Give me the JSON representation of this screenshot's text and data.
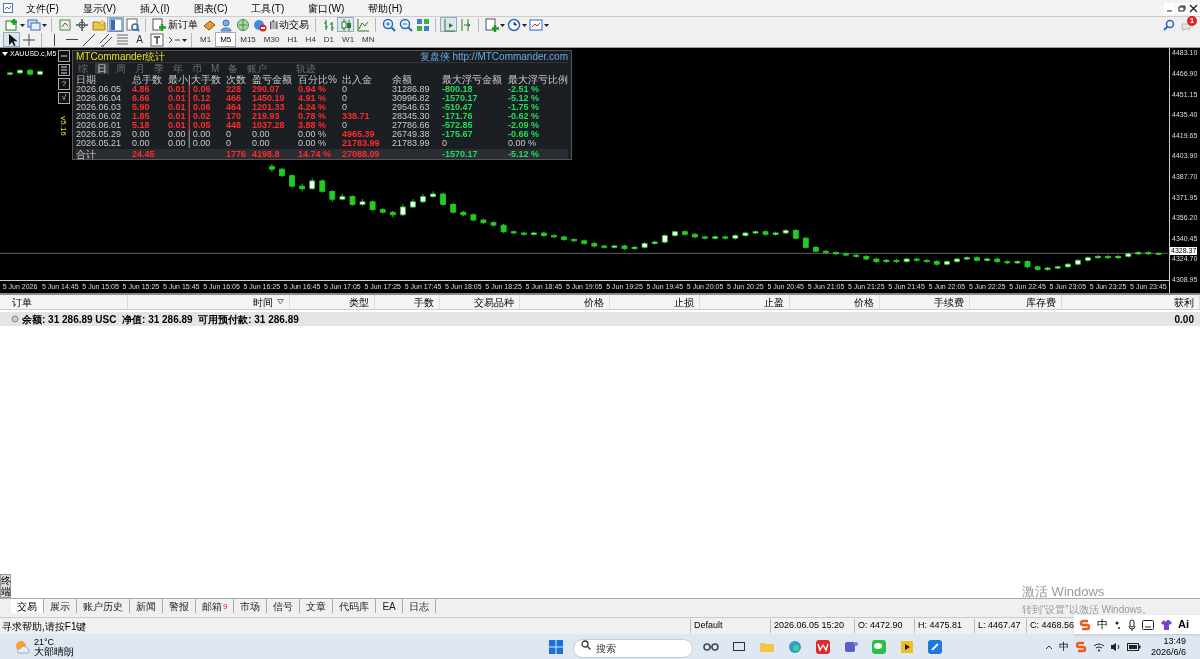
{
  "menu": [
    "文件(F)",
    "显示(V)",
    "插入(I)",
    "图表(C)",
    "工具(T)",
    "窗口(W)",
    "帮助(H)"
  ],
  "toolbar": {
    "new_order": "新订单",
    "auto_trading": "自动交易",
    "text_tool": "A",
    "notification_count": "1"
  },
  "timeframes": [
    {
      "label": "M1",
      "selected": false
    },
    {
      "label": "M5",
      "selected": true
    },
    {
      "label": "M15",
      "selected": false
    },
    {
      "label": "M30",
      "selected": false
    },
    {
      "label": "H1",
      "selected": false
    },
    {
      "label": "H4",
      "selected": false
    },
    {
      "label": "D1",
      "selected": false
    },
    {
      "label": "W1",
      "selected": false
    },
    {
      "label": "MN",
      "selected": false
    }
  ],
  "chart": {
    "tab": "XAUUSD.c,M5",
    "version": "v5.16",
    "current_price": "4328.37",
    "chart_data": {
      "type": "candlestick",
      "ylim": [
        4308.95,
        4483.1
      ],
      "ref_lines": [
        {
          "axis": "y",
          "value": 4328.37
        }
      ],
      "yticks": [
        {
          "value": 4483.1,
          "label": "4483.10"
        },
        {
          "value": 4466.9,
          "label": "4466.90"
        },
        {
          "value": 4451.15,
          "label": "4451.15"
        },
        {
          "value": 4435.4,
          "label": "4435.40"
        },
        {
          "value": 4419.65,
          "label": "4419.65"
        },
        {
          "value": 4403.9,
          "label": "4403.90"
        },
        {
          "value": 4387.7,
          "label": "4387.70"
        },
        {
          "value": 4371.95,
          "label": "4371.95"
        },
        {
          "value": 4356.2,
          "label": "4356.20"
        },
        {
          "value": 4340.45,
          "label": "4340.45"
        },
        {
          "value": 4324.7,
          "label": "4324.70"
        },
        {
          "value": 4308.95,
          "label": "4308.95"
        }
      ],
      "categories": [
        null,
        "5 Jun 2026",
        null,
        null,
        null,
        "5 Jun 14:45",
        null,
        null,
        null,
        "5 Jun 15:05",
        null,
        null,
        null,
        "5 Jun 15:25",
        null,
        null,
        null,
        "5 Jun 15:45",
        null,
        null,
        null,
        "5 Jun 16:05",
        null,
        null,
        null,
        "5 Jun 16:25",
        null,
        null,
        null,
        "5 Jun 16:45",
        null,
        null,
        null,
        "5 Jun 17:05",
        null,
        null,
        null,
        "5 Jun 17:25",
        null,
        null,
        null,
        "5 Jun 17:45",
        null,
        null,
        null,
        "5 Jun 18:05",
        null,
        null,
        null,
        "5 Jun 18:25",
        null,
        null,
        null,
        "5 Jun 18:45",
        null,
        null,
        null,
        "5 Jun 19:05",
        null,
        null,
        null,
        "5 Jun 19:25",
        null,
        null,
        null,
        "5 Jun 19:45",
        null,
        null,
        null,
        "5 Jun 20:05",
        null,
        null,
        null,
        "5 Jun 20:25",
        null,
        null,
        null,
        "5 Jun 20:45",
        null,
        null,
        null,
        "5 Jun 21:05",
        null,
        null,
        null,
        "5 Jun 21:25",
        null,
        null,
        null,
        "5 Jun 21:45",
        null,
        null,
        null,
        "5 Jun 22:05",
        null,
        null,
        null,
        "5 Jun 22:25",
        null,
        null,
        null,
        "5 Jun 22:45",
        null,
        null,
        null,
        "5 Jun 23:05",
        null,
        null,
        null,
        "5 Jun 23:25",
        null,
        null,
        null,
        "5 Jun 23:45",
        null
      ],
      "ohlc": [
        [
          4466,
          4468,
          4465,
          4467
        ],
        [
          4467,
          4470,
          4466,
          4469
        ],
        [
          4469,
          4470,
          4465,
          4466
        ],
        [
          4466,
          4469,
          4465,
          4468
        ],
        null,
        null,
        null,
        null,
        null,
        null,
        null,
        null,
        null,
        null,
        null,
        null,
        null,
        null,
        null,
        null,
        null,
        null,
        null,
        null,
        null,
        null,
        [
          4395,
          4397,
          4391,
          4393
        ],
        [
          4393,
          4394,
          4387,
          4388
        ],
        [
          4388,
          4389,
          4379,
          4380
        ],
        [
          4380,
          4382,
          4376,
          4378
        ],
        [
          4378,
          4386,
          4377,
          4384
        ],
        [
          4384,
          4385,
          4375,
          4376
        ],
        [
          4376,
          4377,
          4368,
          4370
        ],
        [
          4370,
          4374,
          4369,
          4372
        ],
        [
          4372,
          4373,
          4365,
          4366
        ],
        [
          4366,
          4370,
          4365,
          4368
        ],
        [
          4368,
          4369,
          4361,
          4362
        ],
        [
          4362,
          4363,
          4359,
          4360
        ],
        [
          4360,
          4361,
          4356,
          4358
        ],
        [
          4358,
          4366,
          4357,
          4364
        ],
        [
          4364,
          4370,
          4363,
          4368
        ],
        [
          4368,
          4374,
          4367,
          4372
        ],
        [
          4372,
          4376,
          4371,
          4374
        ],
        [
          4374,
          4375,
          4365,
          4366
        ],
        [
          4366,
          4367,
          4359,
          4360
        ],
        [
          4360,
          4361,
          4357,
          4358
        ],
        [
          4358,
          4359,
          4353,
          4354
        ],
        [
          4354,
          4355,
          4351,
          4352
        ],
        [
          4352,
          4353,
          4349,
          4350
        ],
        [
          4350,
          4351,
          4344,
          4345
        ],
        [
          4345,
          4346,
          4343,
          4344
        ],
        [
          4344,
          4345,
          4342,
          4343
        ],
        [
          4343,
          4345,
          4342,
          4344
        ],
        [
          4344,
          4345,
          4341,
          4342
        ],
        [
          4342,
          4343,
          4340,
          4341
        ],
        [
          4341,
          4342,
          4338,
          4339
        ],
        [
          4339,
          4340,
          4337,
          4338
        ],
        [
          4338,
          4339,
          4335,
          4336
        ],
        [
          4336,
          4337,
          4333,
          4334
        ],
        [
          4334,
          4335,
          4332,
          4333
        ],
        [
          4333,
          4335,
          4332,
          4334
        ],
        [
          4334,
          4335,
          4331,
          4332
        ],
        [
          4332,
          4334,
          4331,
          4333
        ],
        [
          4333,
          4337,
          4332,
          4336
        ],
        [
          4336,
          4338,
          4335,
          4337
        ],
        [
          4337,
          4343,
          4336,
          4342
        ],
        [
          4342,
          4346,
          4341,
          4345
        ],
        [
          4345,
          4346,
          4342,
          4343
        ],
        [
          4343,
          4344,
          4340,
          4341
        ],
        [
          4341,
          4342,
          4339,
          4340
        ],
        [
          4340,
          4342,
          4339,
          4341
        ],
        [
          4341,
          4342,
          4339,
          4340
        ],
        [
          4340,
          4343,
          4339,
          4342
        ],
        [
          4342,
          4345,
          4341,
          4344
        ],
        [
          4344,
          4346,
          4343,
          4345
        ],
        [
          4345,
          4346,
          4342,
          4343
        ],
        [
          4343,
          4345,
          4342,
          4344
        ],
        [
          4344,
          4347,
          4343,
          4346
        ],
        [
          4346,
          4347,
          4339,
          4340
        ],
        [
          4340,
          4341,
          4332,
          4333
        ],
        [
          4333,
          4334,
          4329,
          4330
        ],
        [
          4330,
          4331,
          4328,
          4329
        ],
        [
          4329,
          4330,
          4327,
          4328
        ],
        [
          4328,
          4329,
          4326,
          4327
        ],
        [
          4327,
          4328,
          4325,
          4326
        ],
        [
          4326,
          4327,
          4323,
          4324
        ],
        [
          4324,
          4325,
          4321,
          4322
        ],
        [
          4322,
          4324,
          4321,
          4323
        ],
        [
          4323,
          4324,
          4321,
          4322
        ],
        [
          4322,
          4325,
          4321,
          4324
        ],
        [
          4324,
          4325,
          4322,
          4323
        ],
        [
          4323,
          4324,
          4321,
          4322
        ],
        [
          4322,
          4323,
          4319,
          4320
        ],
        [
          4320,
          4323,
          4319,
          4322
        ],
        [
          4322,
          4325,
          4321,
          4324
        ],
        [
          4324,
          4326,
          4323,
          4325
        ],
        [
          4325,
          4326,
          4322,
          4323
        ],
        [
          4323,
          4325,
          4322,
          4324
        ],
        [
          4324,
          4325,
          4321,
          4322
        ],
        [
          4322,
          4323,
          4320,
          4321
        ],
        [
          4321,
          4323,
          4320,
          4322
        ],
        [
          4322,
          4323,
          4317,
          4318
        ],
        [
          4318,
          4319,
          4315,
          4316
        ],
        [
          4316,
          4318,
          4315,
          4317
        ],
        [
          4317,
          4319,
          4316,
          4318
        ],
        [
          4318,
          4321,
          4317,
          4320
        ],
        [
          4320,
          4324,
          4319,
          4323
        ],
        [
          4323,
          4326,
          4322,
          4325
        ],
        [
          4325,
          4327,
          4324,
          4326
        ],
        [
          4326,
          4327,
          4324,
          4325
        ],
        [
          4325,
          4327,
          4324,
          4326
        ],
        [
          4326,
          4329,
          4325,
          4328
        ],
        [
          4328,
          4330,
          4327,
          4329
        ],
        [
          4329,
          4330,
          4327,
          4328
        ],
        [
          4328,
          4329,
          4327,
          4328.37
        ]
      ]
    }
  },
  "stats_panel": {
    "title": "MTCommander统计",
    "brand": "复盘侠 http://MTCommander.com",
    "side_buttons": [
      "?",
      "√"
    ],
    "tabs": [
      {
        "label": "综",
        "selected": false
      },
      {
        "label": "日",
        "selected": true
      },
      {
        "label": "周",
        "selected": false
      },
      {
        "label": "月",
        "selected": false
      },
      {
        "label": "季",
        "selected": false
      },
      {
        "label": "年",
        "selected": false
      },
      {
        "label": "币",
        "selected": false
      },
      {
        "label": "M",
        "selected": false
      },
      {
        "label": "备",
        "selected": false
      },
      {
        "label": "账户",
        "selected": false
      },
      {
        "label": "轨迹",
        "selected": false
      }
    ],
    "columns": [
      "日期",
      "总手数",
      "最小|大手数",
      "次数",
      "盈亏金额",
      "百分比%",
      "出入金",
      "余额",
      "最大浮亏金额",
      "最大浮亏比例"
    ],
    "rows": [
      {
        "cells": [
          "2026.06.05",
          {
            "text": "4.86",
            "color": "#ff2a2a"
          },
          {
            "text": "0.01 | 0.06",
            "color": "#ff2a2a"
          },
          {
            "text": "228",
            "color": "#ff2a2a"
          },
          {
            "text": "290.07",
            "color": "#ff2a2a"
          },
          {
            "text": "0.94 %",
            "color": "#ff2a2a"
          },
          "0",
          "31286.89",
          {
            "text": "-800.18",
            "color": "#22dd55"
          },
          {
            "text": "-2.51 %",
            "color": "#22dd55"
          }
        ]
      },
      {
        "cells": [
          "2026.06.04",
          {
            "text": "6.66",
            "color": "#ff2a2a"
          },
          {
            "text": "0.01 | 0.12",
            "color": "#ff2a2a"
          },
          {
            "text": "466",
            "color": "#ff2a2a"
          },
          {
            "text": "1450.19",
            "color": "#ff2a2a"
          },
          {
            "text": "4.91 %",
            "color": "#ff2a2a"
          },
          "0",
          "30996.82",
          {
            "text": "-1570.17",
            "color": "#22dd55"
          },
          {
            "text": "-5.12 %",
            "color": "#22dd55"
          }
        ]
      },
      {
        "cells": [
          "2026.06.03",
          {
            "text": "5.90",
            "color": "#ff2a2a"
          },
          {
            "text": "0.01 | 0.06",
            "color": "#ff2a2a"
          },
          {
            "text": "464",
            "color": "#ff2a2a"
          },
          {
            "text": "1201.33",
            "color": "#ff2a2a"
          },
          {
            "text": "4.24 %",
            "color": "#ff2a2a"
          },
          "0",
          "29546.63",
          {
            "text": "-510.47",
            "color": "#22dd55"
          },
          {
            "text": "-1.75 %",
            "color": "#22dd55"
          }
        ]
      },
      {
        "cells": [
          "2026.06.02",
          {
            "text": "1.85",
            "color": "#ff2a2a"
          },
          {
            "text": "0.01 | 0.02",
            "color": "#ff2a2a"
          },
          {
            "text": "170",
            "color": "#ff2a2a"
          },
          {
            "text": "219.93",
            "color": "#ff2a2a"
          },
          {
            "text": "0.78 %",
            "color": "#ff2a2a"
          },
          {
            "text": "338.71",
            "color": "#ff2a2a"
          },
          "28345.30",
          {
            "text": "-171.76",
            "color": "#22dd55"
          },
          {
            "text": "-0.62 %",
            "color": "#22dd55"
          }
        ]
      },
      {
        "cells": [
          "2026.06.01",
          {
            "text": "5.18",
            "color": "#ff2a2a"
          },
          {
            "text": "0.01 | 0.05",
            "color": "#ff2a2a"
          },
          {
            "text": "448",
            "color": "#ff2a2a"
          },
          {
            "text": "1037.28",
            "color": "#ff2a2a"
          },
          {
            "text": "3.88 %",
            "color": "#ff2a2a"
          },
          "0",
          "27786.66",
          {
            "text": "-572.85",
            "color": "#22dd55"
          },
          {
            "text": "-2.09 %",
            "color": "#22dd55"
          }
        ]
      },
      {
        "cells": [
          "2026.05.29",
          "0.00",
          "0.00 | 0.00",
          "0",
          "0.00",
          "0.00 %",
          {
            "text": "4965.39",
            "color": "#ff2a2a"
          },
          "26749.38",
          {
            "text": "-175.67",
            "color": "#22dd55"
          },
          {
            "text": "-0.66 %",
            "color": "#22dd55"
          }
        ]
      },
      {
        "cells": [
          "2026.05.21",
          "0.00",
          "0.00 | 0.00",
          "0",
          "0.00",
          "0.00 %",
          {
            "text": "21783.99",
            "color": "#ff2a2a"
          },
          "21783.99",
          "0",
          "0.00 %"
        ]
      }
    ],
    "total": {
      "label": "合计",
      "lots": {
        "text": "24.45",
        "color": "#ff2a2a"
      },
      "trades": {
        "text": "1776",
        "color": "#ff2a2a"
      },
      "profit": {
        "text": "4198.8",
        "color": "#ff2a2a"
      },
      "percent": {
        "text": "14.74 %",
        "color": "#ff2a2a"
      },
      "deposits": {
        "text": "27088.09",
        "color": "#ff2a2a"
      },
      "max_drawdown": {
        "text": "-1570.17",
        "color": "#22dd55"
      },
      "max_drawdown_pct": {
        "text": "-5.12 %",
        "color": "#22dd55"
      }
    }
  },
  "terminal": {
    "columns": [
      "订单",
      "时间",
      "类型",
      "手数",
      "交易品种",
      "价格",
      "止损",
      "止盈",
      "价格",
      "手续费",
      "库存费",
      "获利"
    ],
    "balance": "余额: 31 286.89 USC  净值: 31 286.89  可用预付款: 31 286.89",
    "profit": "0.00"
  },
  "terminal_side_label": "终端",
  "terminal_tabs": [
    {
      "label": "交易",
      "selected": true
    },
    {
      "label": "展示",
      "selected": false
    },
    {
      "label": "账户历史",
      "selected": false
    },
    {
      "label": "新闻",
      "selected": false
    },
    {
      "label": "警报",
      "selected": false
    },
    {
      "label": "邮箱",
      "selected": false,
      "badge": "9"
    },
    {
      "label": "市场",
      "selected": false
    },
    {
      "label": "信号",
      "selected": false
    },
    {
      "label": "文章",
      "selected": false
    },
    {
      "label": "代码库",
      "selected": false
    },
    {
      "label": "EA",
      "selected": false
    },
    {
      "label": "日志",
      "selected": false
    }
  ],
  "activation": {
    "title": "激活 Windows",
    "hint": "转到“设置”以激活 Windows。"
  },
  "status_bar": {
    "help": "寻求帮助,请按F1键",
    "profile": "Default",
    "time": "2026.06.05 15:20",
    "open": "O: 4472.90",
    "high": "H: 4475.81",
    "low": "L: 4467.47",
    "close": "C: 4468.56"
  },
  "ime_bar": {
    "mode": "中",
    "ai": "Ai"
  },
  "taskbar": {
    "temperature": "21°C",
    "weather": "大部晴朗",
    "search_placeholder": "搜索",
    "ime": "中",
    "time": "13:49",
    "date": "2026/6/6"
  }
}
